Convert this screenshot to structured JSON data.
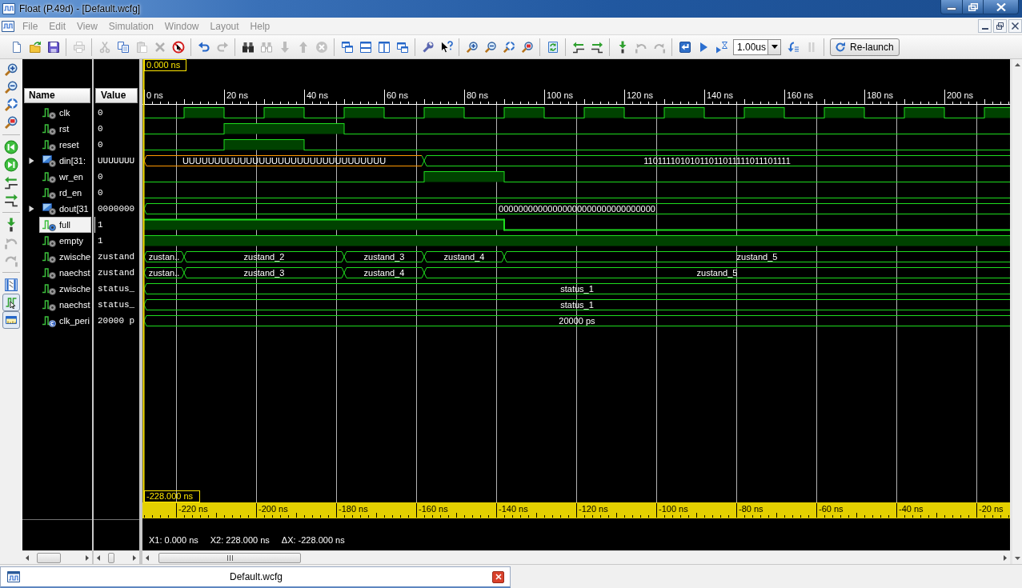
{
  "window": {
    "title": "Float (P.49d) - [Default.wcfg]"
  },
  "menu": [
    {
      "label": "File",
      "disabled": true
    },
    {
      "label": "Edit",
      "disabled": true
    },
    {
      "label": "View",
      "disabled": true
    },
    {
      "label": "Simulation",
      "disabled": true
    },
    {
      "label": "Window",
      "disabled": true
    },
    {
      "label": "Layout",
      "disabled": true
    },
    {
      "label": "Help",
      "disabled": true
    }
  ],
  "toolbar": [
    [
      {
        "kind": "new",
        "disabled": false
      },
      {
        "kind": "open",
        "disabled": false
      },
      {
        "kind": "save",
        "disabled": false
      }
    ],
    [
      {
        "kind": "print",
        "disabled": true
      }
    ],
    [
      {
        "kind": "cut",
        "disabled": true
      },
      {
        "kind": "copy",
        "disabled": false
      },
      {
        "kind": "paste",
        "disabled": true
      },
      {
        "kind": "delete",
        "disabled": true
      },
      {
        "kind": "stop",
        "disabled": false
      }
    ],
    [
      {
        "kind": "undo",
        "disabled": false
      },
      {
        "kind": "redo",
        "disabled": true
      }
    ],
    [
      {
        "kind": "find",
        "disabled": false
      },
      {
        "kind": "find_next",
        "disabled": true
      },
      {
        "kind": "down",
        "disabled": true
      },
      {
        "kind": "up",
        "disabled": true
      },
      {
        "kind": "cancel",
        "disabled": true
      }
    ],
    [
      {
        "kind": "cascade",
        "disabled": false
      },
      {
        "kind": "tile_rows",
        "disabled": false
      },
      {
        "kind": "tile_cols",
        "disabled": false
      },
      {
        "kind": "float",
        "disabled": false
      }
    ],
    [
      {
        "kind": "wrench",
        "disabled": false
      },
      {
        "kind": "help",
        "disabled": false
      }
    ],
    [
      {
        "kind": "zoom_in",
        "disabled": false
      },
      {
        "kind": "zoom_out",
        "disabled": false
      },
      {
        "kind": "zoom_fit",
        "disabled": false
      },
      {
        "kind": "zoom_cursor",
        "disabled": false
      }
    ],
    [
      {
        "kind": "refresh",
        "disabled": false
      }
    ],
    [
      {
        "kind": "step_back",
        "disabled": false
      },
      {
        "kind": "step_fwd",
        "disabled": false
      }
    ],
    [
      {
        "kind": "marker_add",
        "disabled": false
      },
      {
        "kind": "marker_prev",
        "disabled": true
      },
      {
        "kind": "marker_next",
        "disabled": true
      }
    ],
    [
      {
        "kind": "restart",
        "disabled": false
      },
      {
        "kind": "run",
        "disabled": false
      },
      {
        "kind": "run_for",
        "disabled": false
      },
      {
        "kind": "time_field",
        "value": "1.00us",
        "disabled": false
      },
      {
        "kind": "step",
        "disabled": false
      },
      {
        "kind": "pause",
        "disabled": true
      }
    ],
    [
      {
        "kind": "relaunch",
        "label": "Re-launch",
        "disabled": false
      }
    ]
  ],
  "side_toolbar": [
    [
      {
        "kind": "zoom_in",
        "disabled": false,
        "on": false
      },
      {
        "kind": "zoom_out",
        "disabled": false,
        "on": false
      },
      {
        "kind": "zoom_fit",
        "disabled": false,
        "on": false
      },
      {
        "kind": "zoom_cursor",
        "disabled": false,
        "on": false
      }
    ],
    [
      {
        "kind": "go_start",
        "disabled": false,
        "on": false
      },
      {
        "kind": "go_end",
        "disabled": false,
        "on": false
      },
      {
        "kind": "step_back",
        "disabled": false,
        "on": false
      },
      {
        "kind": "step_fwd",
        "disabled": false,
        "on": false
      }
    ],
    [
      {
        "kind": "marker_add",
        "disabled": false,
        "on": false
      },
      {
        "kind": "marker_prev",
        "disabled": true,
        "on": false
      },
      {
        "kind": "marker_next",
        "disabled": true,
        "on": false
      }
    ],
    [
      {
        "kind": "swap",
        "disabled": false,
        "on": false
      },
      {
        "kind": "snap",
        "disabled": false,
        "on": true
      },
      {
        "kind": "ruler",
        "disabled": false,
        "on": true
      }
    ]
  ],
  "columns": {
    "name": "Name",
    "value": "Value"
  },
  "signals": [
    {
      "name": "clk",
      "value": "0",
      "kind": "bit",
      "selected": false,
      "wave": [
        {
          "high": false
        },
        {
          "high": true
        },
        {
          "high": false
        },
        {
          "high": true
        },
        {
          "high": false
        },
        {
          "high": true
        },
        {
          "high": false
        },
        {
          "high": true
        },
        {
          "high": false
        },
        {
          "high": true
        },
        {
          "high": false
        },
        {
          "high": true
        },
        {
          "high": false
        },
        {
          "high": true
        },
        {
          "high": false
        },
        {
          "high": true
        },
        {
          "high": false
        },
        {
          "high": true
        },
        {
          "high": false
        },
        {
          "high": true
        },
        {
          "high": false
        },
        {
          "high": true
        }
      ]
    },
    {
      "name": "rst",
      "value": "0",
      "kind": "bit",
      "selected": false,
      "wave": [
        {
          "high": false
        },
        {
          "high": false
        },
        {
          "high": true
        },
        {
          "high": true
        },
        {
          "high": true
        },
        {
          "high": false
        },
        {
          "high": false
        },
        {
          "high": false
        },
        {
          "high": false
        },
        {
          "high": false
        },
        {
          "high": false
        },
        {
          "high": false
        },
        {
          "high": false
        },
        {
          "high": false
        },
        {
          "high": false
        },
        {
          "high": false
        },
        {
          "high": false
        },
        {
          "high": false
        },
        {
          "high": false
        },
        {
          "high": false
        },
        {
          "high": false
        },
        {
          "high": false
        }
      ]
    },
    {
      "name": "reset",
      "value": "0",
      "kind": "bit",
      "selected": false,
      "wave": [
        {
          "high": false
        },
        {
          "high": false
        },
        {
          "high": true
        },
        {
          "high": true
        },
        {
          "high": false
        },
        {
          "high": false
        },
        {
          "high": false
        },
        {
          "high": false
        },
        {
          "high": false
        },
        {
          "high": false
        },
        {
          "high": false
        },
        {
          "high": false
        },
        {
          "high": false
        },
        {
          "high": false
        },
        {
          "high": false
        },
        {
          "high": false
        },
        {
          "high": false
        },
        {
          "high": false
        },
        {
          "high": false
        },
        {
          "high": false
        },
        {
          "high": false
        },
        {
          "high": false
        }
      ]
    },
    {
      "name": "din[31:",
      "value": "UUUUUUU",
      "kind": "vector",
      "expanded": false,
      "selected": false,
      "wave": [
        {
          "start": true,
          "label": "UUUUUUUUUUUUUUUUUUUUUUUUUUUUUUUU",
          "color": "#ff9900"
        },
        {
          "start": false
        },
        {
          "start": false
        },
        {
          "start": false
        },
        {
          "start": false
        },
        {
          "start": false
        },
        {
          "start": false
        },
        {
          "start": true,
          "label": "11011110101011011011111011101111",
          "color": "#1edc1e"
        },
        {
          "start": false
        },
        {
          "start": false
        },
        {
          "start": false
        },
        {
          "start": false
        },
        {
          "start": false
        },
        {
          "start": false
        },
        {
          "start": false
        },
        {
          "start": false
        },
        {
          "start": false
        },
        {
          "start": false
        },
        {
          "start": false
        },
        {
          "start": false
        },
        {
          "start": false
        },
        {
          "start": false
        }
      ]
    },
    {
      "name": "wr_en",
      "value": "0",
      "kind": "bit",
      "selected": false,
      "wave": [
        {
          "high": false
        },
        {
          "high": false
        },
        {
          "high": false
        },
        {
          "high": false
        },
        {
          "high": false
        },
        {
          "high": false
        },
        {
          "high": false
        },
        {
          "high": true
        },
        {
          "high": true
        },
        {
          "high": false
        },
        {
          "high": false
        },
        {
          "high": false
        },
        {
          "high": false
        },
        {
          "high": false
        },
        {
          "high": false
        },
        {
          "high": false
        },
        {
          "high": false
        },
        {
          "high": false
        },
        {
          "high": false
        },
        {
          "high": false
        },
        {
          "high": false
        },
        {
          "high": false
        }
      ]
    },
    {
      "name": "rd_en",
      "value": "0",
      "kind": "bit",
      "selected": false,
      "wave": [
        {
          "high": false
        },
        {
          "high": false
        },
        {
          "high": false
        },
        {
          "high": false
        },
        {
          "high": false
        },
        {
          "high": false
        },
        {
          "high": false
        },
        {
          "high": false
        },
        {
          "high": false
        },
        {
          "high": false
        },
        {
          "high": false
        },
        {
          "high": false
        },
        {
          "high": false
        },
        {
          "high": false
        },
        {
          "high": false
        },
        {
          "high": false
        },
        {
          "high": false
        },
        {
          "high": false
        },
        {
          "high": false
        },
        {
          "high": false
        },
        {
          "high": false
        },
        {
          "high": false
        }
      ]
    },
    {
      "name": "dout[31",
      "value": "0000000",
      "kind": "vector",
      "expanded": false,
      "selected": false,
      "wave": [
        {
          "start": true,
          "label": "00000000000000000000000000000000",
          "color": "#1edc1e"
        },
        {
          "start": false
        },
        {
          "start": false
        },
        {
          "start": false
        },
        {
          "start": false
        },
        {
          "start": false
        },
        {
          "start": false
        },
        {
          "start": false
        },
        {
          "start": false
        },
        {
          "start": false
        },
        {
          "start": false
        },
        {
          "start": false
        },
        {
          "start": false
        },
        {
          "start": false
        },
        {
          "start": false
        },
        {
          "start": false
        },
        {
          "start": false
        },
        {
          "start": false
        },
        {
          "start": false
        },
        {
          "start": false
        },
        {
          "start": false
        },
        {
          "start": false
        }
      ]
    },
    {
      "name": "full",
      "value": "1",
      "kind": "bit",
      "selected": true,
      "wave": [
        {
          "high": true
        },
        {
          "high": true
        },
        {
          "high": true
        },
        {
          "high": true
        },
        {
          "high": true
        },
        {
          "high": true
        },
        {
          "high": true
        },
        {
          "high": true
        },
        {
          "high": true
        },
        {
          "high": false
        },
        {
          "high": false
        },
        {
          "high": false
        },
        {
          "high": false
        },
        {
          "high": false
        },
        {
          "high": false
        },
        {
          "high": false
        },
        {
          "high": false
        },
        {
          "high": false
        },
        {
          "high": false
        },
        {
          "high": false
        },
        {
          "high": false
        },
        {
          "high": false
        }
      ]
    },
    {
      "name": "empty",
      "value": "1",
      "kind": "bit",
      "selected": false,
      "wave": [
        {
          "high": true
        },
        {
          "high": true
        },
        {
          "high": true
        },
        {
          "high": true
        },
        {
          "high": true
        },
        {
          "high": true
        },
        {
          "high": true
        },
        {
          "high": true
        },
        {
          "high": true
        },
        {
          "high": true
        },
        {
          "high": true
        },
        {
          "high": true
        },
        {
          "high": true
        },
        {
          "high": true
        },
        {
          "high": true
        },
        {
          "high": true
        },
        {
          "high": true
        },
        {
          "high": true
        },
        {
          "high": true
        },
        {
          "high": true
        },
        {
          "high": true
        },
        {
          "high": true
        }
      ]
    },
    {
      "name": "zwische",
      "value": "zustand",
      "kind": "enum",
      "selected": false,
      "wave": [
        {
          "start": true,
          "label": "zustan..",
          "color": "#1edc1e"
        },
        {
          "start": true,
          "label": "zustand_2",
          "color": "#1edc1e"
        },
        {
          "start": false
        },
        {
          "start": false
        },
        {
          "start": false
        },
        {
          "start": true,
          "label": "zustand_3",
          "color": "#1edc1e"
        },
        {
          "start": false
        },
        {
          "start": true,
          "label": "zustand_4",
          "color": "#1edc1e"
        },
        {
          "start": false
        },
        {
          "start": true,
          "label": "zustand_5",
          "color": "#1edc1e"
        },
        {
          "start": false
        },
        {
          "start": false
        },
        {
          "start": false
        },
        {
          "start": false
        },
        {
          "start": false
        },
        {
          "start": false
        },
        {
          "start": false
        },
        {
          "start": false
        },
        {
          "start": false
        },
        {
          "start": false
        },
        {
          "start": false
        },
        {
          "start": false
        }
      ]
    },
    {
      "name": "naechst",
      "value": "zustand",
      "kind": "enum",
      "selected": false,
      "wave": [
        {
          "start": true,
          "label": "zustan..",
          "color": "#1edc1e"
        },
        {
          "start": true,
          "label": "zustand_3",
          "color": "#1edc1e"
        },
        {
          "start": false
        },
        {
          "start": false
        },
        {
          "start": false
        },
        {
          "start": true,
          "label": "zustand_4",
          "color": "#1edc1e"
        },
        {
          "start": false
        },
        {
          "start": true,
          "label": "zustand_5",
          "color": "#1edc1e"
        },
        {
          "start": false
        },
        {
          "start": false
        },
        {
          "start": false
        },
        {
          "start": false
        },
        {
          "start": false
        },
        {
          "start": false
        },
        {
          "start": false
        },
        {
          "start": false
        },
        {
          "start": false
        },
        {
          "start": false
        },
        {
          "start": false
        },
        {
          "start": false
        },
        {
          "start": false
        },
        {
          "start": false
        }
      ]
    },
    {
      "name": "zwische",
      "value": "status_",
      "kind": "enum",
      "selected": false,
      "wave": [
        {
          "start": true,
          "label": "status_1",
          "color": "#1edc1e"
        },
        {
          "start": false
        },
        {
          "start": false
        },
        {
          "start": false
        },
        {
          "start": false
        },
        {
          "start": false
        },
        {
          "start": false
        },
        {
          "start": false
        },
        {
          "start": false
        },
        {
          "start": false
        },
        {
          "start": false
        },
        {
          "start": false
        },
        {
          "start": false
        },
        {
          "start": false
        },
        {
          "start": false
        },
        {
          "start": false
        },
        {
          "start": false
        },
        {
          "start": false
        },
        {
          "start": false
        },
        {
          "start": false
        },
        {
          "start": false
        },
        {
          "start": false
        }
      ]
    },
    {
      "name": "naechst",
      "value": "status_",
      "kind": "enum",
      "selected": false,
      "wave": [
        {
          "start": true,
          "label": "status_1",
          "color": "#1edc1e"
        },
        {
          "start": false
        },
        {
          "start": false
        },
        {
          "start": false
        },
        {
          "start": false
        },
        {
          "start": false
        },
        {
          "start": false
        },
        {
          "start": false
        },
        {
          "start": false
        },
        {
          "start": false
        },
        {
          "start": false
        },
        {
          "start": false
        },
        {
          "start": false
        },
        {
          "start": false
        },
        {
          "start": false
        },
        {
          "start": false
        },
        {
          "start": false
        },
        {
          "start": false
        },
        {
          "start": false
        },
        {
          "start": false
        },
        {
          "start": false
        },
        {
          "start": false
        }
      ]
    },
    {
      "name": "clk_peri",
      "value": "20000 p",
      "kind": "constant",
      "selected": false,
      "wave": [
        {
          "start": true,
          "label": "20000 ps",
          "color": "#1edc1e"
        },
        {
          "start": false
        },
        {
          "start": false
        },
        {
          "start": false
        },
        {
          "start": false
        },
        {
          "start": false
        },
        {
          "start": false
        },
        {
          "start": false
        },
        {
          "start": false
        },
        {
          "start": false
        },
        {
          "start": false
        },
        {
          "start": false
        },
        {
          "start": false
        },
        {
          "start": false
        },
        {
          "start": false
        },
        {
          "start": false
        },
        {
          "start": false
        },
        {
          "start": false
        },
        {
          "start": false
        },
        {
          "start": false
        },
        {
          "start": false
        },
        {
          "start": false
        }
      ]
    }
  ],
  "cursor": {
    "label": "0.000 ns"
  },
  "time_ruler": [
    "0 ns",
    "20 ns",
    "40 ns",
    "60 ns",
    "80 ns",
    "100 ns",
    "120 ns",
    "140 ns",
    "160 ns",
    "180 ns",
    "200 ns"
  ],
  "offset_cursor": {
    "label": "-228.000 ns"
  },
  "offset_ruler": [
    "-220 ns",
    "-200 ns",
    "-180 ns",
    "-160 ns",
    "-140 ns",
    "-120 ns",
    "-100 ns",
    "-80 ns",
    "-60 ns",
    "-40 ns",
    "-20 ns"
  ],
  "cursor_readouts": [
    "X1: 0.000 ns",
    "X2: 228.000 ns",
    "ΔX: -228.000 ns"
  ],
  "document_tab": {
    "label": "Default.wcfg",
    "selected": true
  }
}
